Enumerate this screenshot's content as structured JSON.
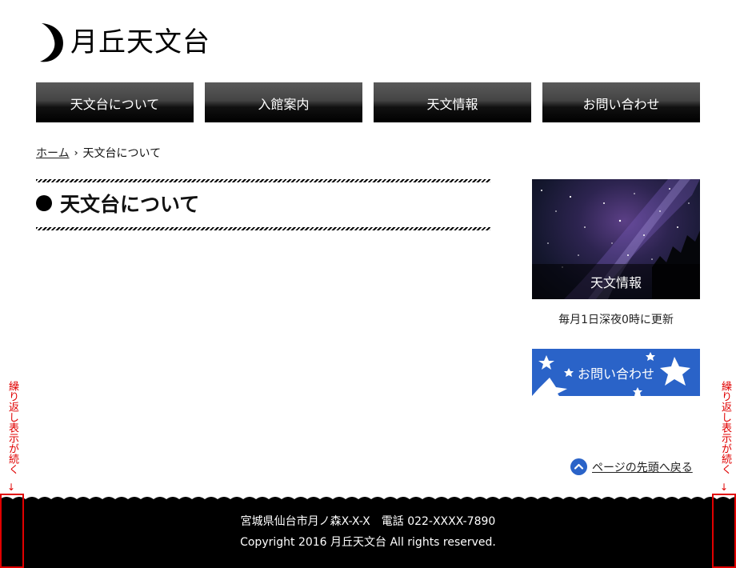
{
  "header": {
    "site_title": "月丘天文台",
    "logo_icon": "crescent-moon-icon"
  },
  "nav": {
    "items": [
      {
        "label": "天文台について"
      },
      {
        "label": "入館案内"
      },
      {
        "label": "天文情報"
      },
      {
        "label": "お問い合わせ"
      }
    ]
  },
  "breadcrumb": {
    "home": "ホーム",
    "separator": "›",
    "current": "天文台について"
  },
  "main": {
    "title": "天文台について"
  },
  "sidebar": {
    "banner_label": "天文情報",
    "banner_note": "毎月1日深夜0時に更新",
    "contact_label": "お問い合わせ"
  },
  "back_to_top": {
    "label": "ページの先頭へ戻る",
    "icon": "chevron-up-circle-icon"
  },
  "footer": {
    "address": "宮城県仙台市月ノ森X-X-X　電話 022-XXXX-7890",
    "copyright": "Copyright 2016 月丘天文台 All rights reserved."
  },
  "annotations": {
    "repeat_note": "繰り返し表示が続く",
    "arrow": "↓"
  },
  "colors": {
    "accent_blue": "#2a63c8",
    "annotation_red": "#e00000",
    "footer_bg": "#000000"
  }
}
